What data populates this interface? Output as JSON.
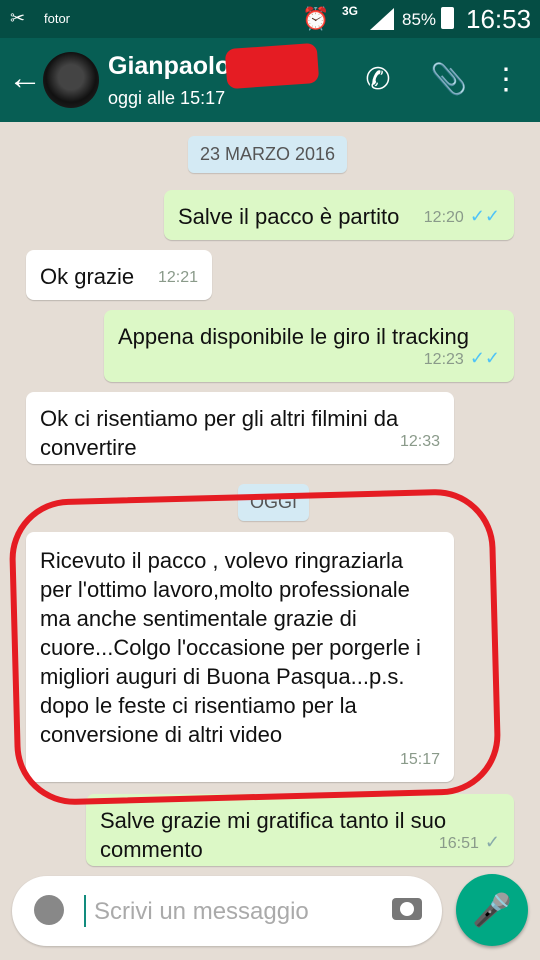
{
  "status_bar": {
    "app_name": "fotor",
    "network": "3G",
    "battery": "85%",
    "time": "16:53"
  },
  "header": {
    "contact_name": "Gianpaolo",
    "last_seen": "oggi alle 15:17"
  },
  "chat": {
    "date_separator_1": "23 MARZO 2016",
    "date_separator_2": "OGGI",
    "messages": [
      {
        "text": "Salve il pacco è partito",
        "time": "12:20"
      },
      {
        "text": "Ok grazie",
        "time": "12:21"
      },
      {
        "text": "Appena disponibile le giro il tracking",
        "time": "12:23"
      },
      {
        "text": "Ok ci risentiamo per gli altri filmini da convertire",
        "time": "12:33"
      },
      {
        "text": "Ricevuto il pacco , volevo ringraziarla per l'ottimo lavoro,molto professionale ma anche sentimentale grazie di cuore...Colgo l'occasione per porgerle i migliori auguri di Buona Pasqua...p.s. dopo le feste ci risentiamo per la conversione di altri video",
        "time": "15:17"
      },
      {
        "text": "Salve grazie mi gratifica tanto il suo commento",
        "time": "16:51"
      }
    ]
  },
  "input": {
    "placeholder": "Scrivi un messaggio"
  },
  "icons": {
    "back": "arrow-left-icon",
    "call": "phone-icon",
    "attach": "paperclip-icon",
    "menu": "more-vert-icon",
    "emoji": "emoji-icon",
    "camera": "camera-icon",
    "mic": "mic-icon"
  },
  "colors": {
    "header": "#075e54",
    "status_bar": "#054d44",
    "outgoing_bubble": "#dcf8c6",
    "incoming_bubble": "#ffffff",
    "read_ticks": "#4fc3f7",
    "annotation": "#e51c23",
    "fab": "#00a884"
  }
}
